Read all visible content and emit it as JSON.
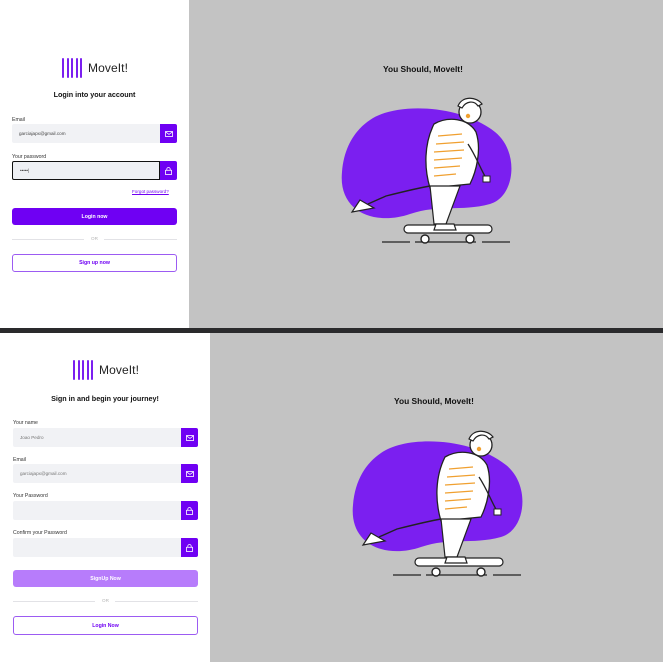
{
  "brand": {
    "name": "MoveIt!",
    "tagline": "You Should, MoveIt!"
  },
  "login_screen": {
    "heading": "Login into your account",
    "email_label": "Email",
    "email_value": "garciajapx@gmail.com",
    "password_label": "Your password",
    "password_value": "•••••|",
    "forgot_label": "Forgot password?",
    "login_button": "Login now",
    "or_text": "OR",
    "signup_button": "Sign up now"
  },
  "signup_screen": {
    "heading": "Sign in and begin your journey!",
    "name_label": "Your name",
    "name_placeholder": "Joao Pedro",
    "email_label": "Email",
    "email_placeholder": "garciajapx@gmail.com",
    "password_label": "Your Password",
    "confirm_label": "Confirm your Password",
    "signup_button": "SignUp Now",
    "or_text": "OR",
    "login_button": "Login Now"
  },
  "colors": {
    "accent": "#6f00f3",
    "accent_soft": "#b77cfb",
    "blob": "#7b1ff0",
    "background": "#c3c3c3"
  },
  "icons": [
    "logo-bars-icon",
    "mail-icon",
    "lock-icon",
    "skater-illustration"
  ]
}
